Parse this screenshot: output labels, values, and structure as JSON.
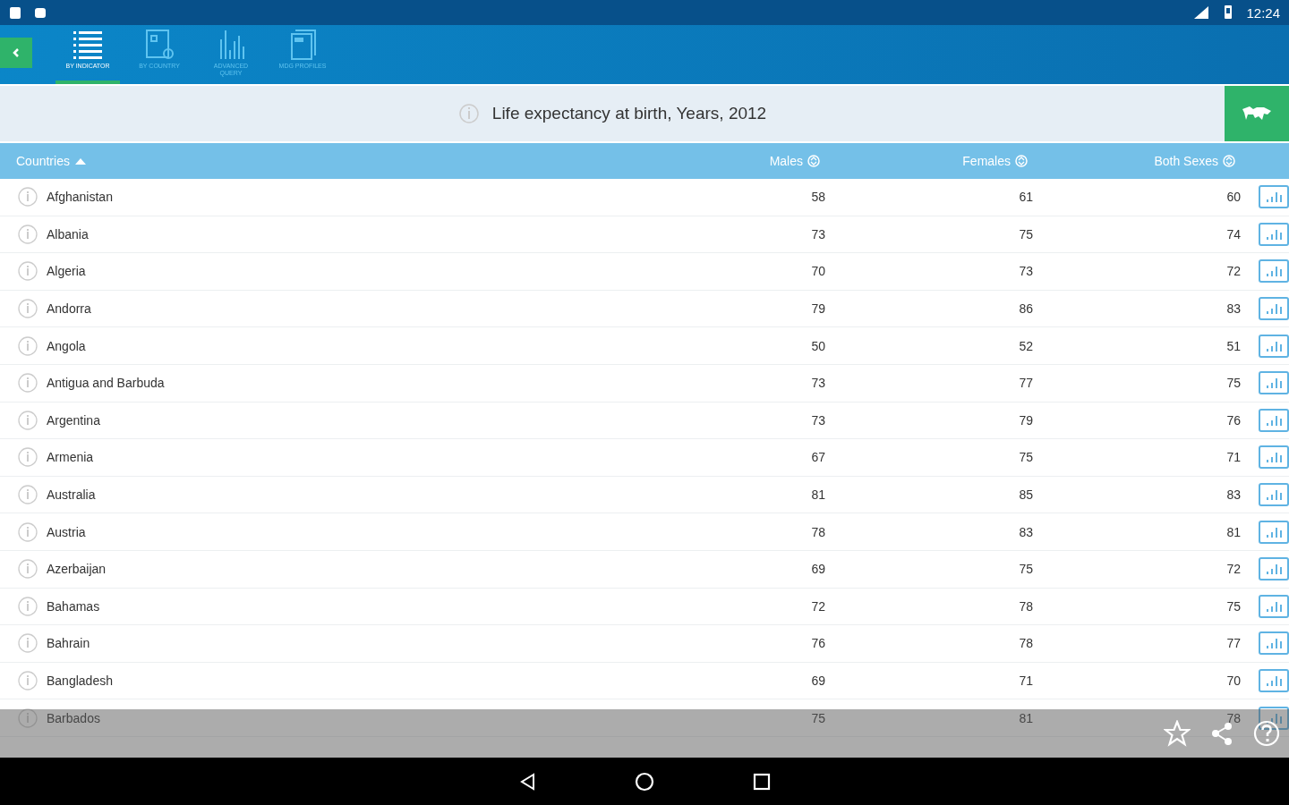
{
  "status_bar": {
    "time": "12:24"
  },
  "tabs": [
    {
      "label": "BY INDICATOR",
      "kind": "list",
      "selected": true
    },
    {
      "label": "BY COUNTRY",
      "kind": "country",
      "selected": false
    },
    {
      "label": "ADVANCED QUERY",
      "kind": "query",
      "selected": false
    },
    {
      "label": "MDG PROFILES",
      "kind": "profiles",
      "selected": false
    }
  ],
  "indicator_title": "Life expectancy at birth, Years, 2012",
  "table": {
    "columns": [
      {
        "label": "Countries",
        "sorted": true
      },
      {
        "label": "Males",
        "sorted": false
      },
      {
        "label": "Females",
        "sorted": false
      },
      {
        "label": "Both Sexes",
        "sorted": false
      }
    ],
    "rows": [
      [
        "Afghanistan",
        "58",
        "61",
        "60"
      ],
      [
        "Albania",
        "73",
        "75",
        "74"
      ],
      [
        "Algeria",
        "70",
        "73",
        "72"
      ],
      [
        "Andorra",
        "79",
        "86",
        "83"
      ],
      [
        "Angola",
        "50",
        "52",
        "51"
      ],
      [
        "Antigua and Barbuda",
        "73",
        "77",
        "75"
      ],
      [
        "Argentina",
        "73",
        "79",
        "76"
      ],
      [
        "Armenia",
        "67",
        "75",
        "71"
      ],
      [
        "Australia",
        "81",
        "85",
        "83"
      ],
      [
        "Austria",
        "78",
        "83",
        "81"
      ],
      [
        "Azerbaijan",
        "69",
        "75",
        "72"
      ],
      [
        "Bahamas",
        "72",
        "78",
        "75"
      ],
      [
        "Bahrain",
        "76",
        "78",
        "77"
      ],
      [
        "Bangladesh",
        "69",
        "71",
        "70"
      ],
      [
        "Barbados",
        "75",
        "81",
        "78"
      ]
    ]
  }
}
